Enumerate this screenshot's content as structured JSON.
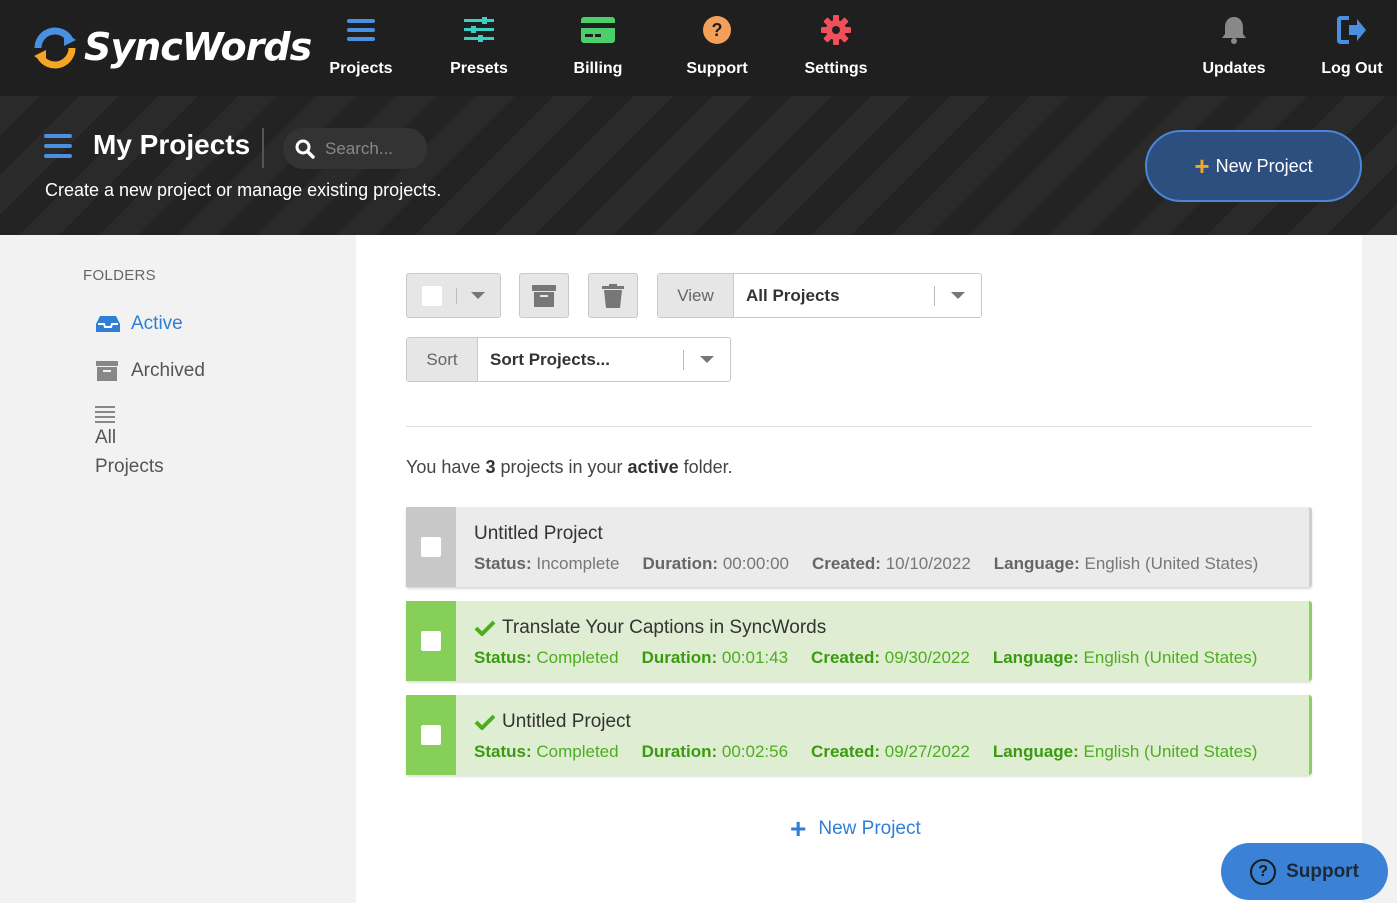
{
  "app": {
    "name": "SyncWords"
  },
  "nav": {
    "items": [
      {
        "label": "Projects",
        "icon": "list-icon",
        "color": "#4a90e2"
      },
      {
        "label": "Presets",
        "icon": "sliders-icon",
        "color": "#3ecfc3"
      },
      {
        "label": "Billing",
        "icon": "credit-card-icon",
        "color": "#4ccf6a"
      },
      {
        "label": "Support",
        "icon": "question-circle-icon",
        "color": "#f5a05a"
      },
      {
        "label": "Settings",
        "icon": "gear-icon",
        "color": "#f0505a"
      }
    ],
    "right": [
      {
        "label": "Updates",
        "icon": "bell-icon",
        "color": "#888888"
      },
      {
        "label": "Log Out",
        "icon": "logout-icon",
        "color": "#4a90e2"
      }
    ]
  },
  "header": {
    "title": "My Projects",
    "subtitle": "Create a new project or manage existing projects.",
    "search_placeholder": "Search...",
    "new_project_label": "New Project"
  },
  "sidebar": {
    "heading": "FOLDERS",
    "items": [
      {
        "label": "Active",
        "icon": "inbox-icon",
        "active": true
      },
      {
        "label": "Archived",
        "icon": "archive-icon",
        "active": false
      },
      {
        "label": "All Projects",
        "icon": "list-icon",
        "active": false
      }
    ]
  },
  "toolbar": {
    "view_label": "View",
    "view_value": "All Projects",
    "sort_label": "Sort",
    "sort_value": "Sort Projects..."
  },
  "summary": {
    "prefix": "You have",
    "count": "3",
    "middle": "projects in your",
    "folder": "active",
    "suffix": "folder."
  },
  "labels": {
    "status": "Status:",
    "duration": "Duration:",
    "created": "Created:",
    "language": "Language:"
  },
  "projects": [
    {
      "title": "Untitled Project",
      "status": "Incomplete",
      "duration": "00:00:00",
      "created": "10/10/2022",
      "language": "English (United States)"
    },
    {
      "title": "Translate Your Captions in SyncWords",
      "status": "Completed",
      "duration": "00:01:43",
      "created": "09/30/2022",
      "language": "English (United States)"
    },
    {
      "title": "Untitled Project",
      "status": "Completed",
      "duration": "00:02:56",
      "created": "09/27/2022",
      "language": "English (United States)"
    }
  ],
  "bottom_new_project": "New Project",
  "support_fab": "Support",
  "colors": {
    "accent": "#4a90e2",
    "completed": "#86d05a",
    "cta_border": "#4a86d4",
    "plus_orange": "#f5a623"
  }
}
